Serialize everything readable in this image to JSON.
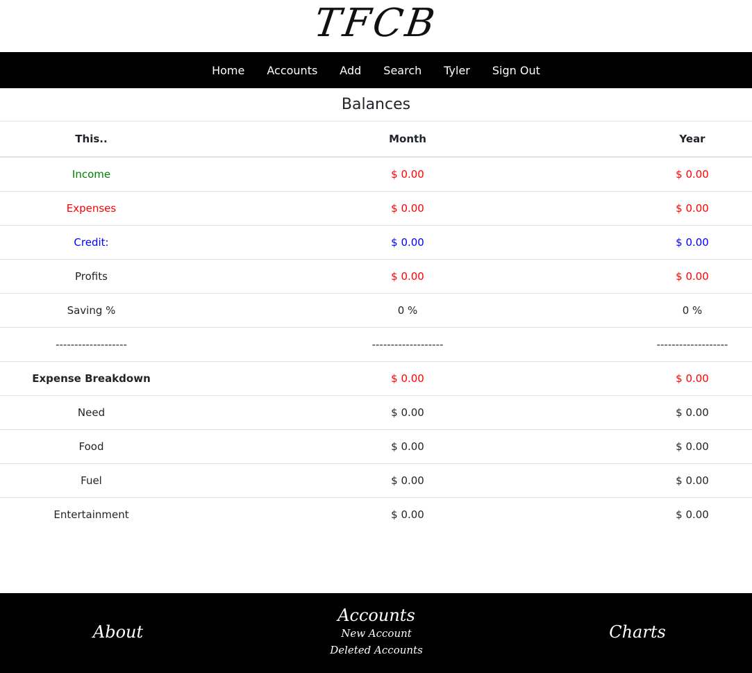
{
  "brand": {
    "logo_text": "TFCB"
  },
  "nav": {
    "items": [
      {
        "label": "Home"
      },
      {
        "label": "Accounts"
      },
      {
        "label": "Add"
      },
      {
        "label": "Search"
      },
      {
        "label": "Tyler"
      },
      {
        "label": "Sign Out"
      }
    ]
  },
  "balances": {
    "title": "Balances",
    "headers": {
      "col1": "This..",
      "col2": "Month",
      "col3": "Year"
    },
    "rows": [
      {
        "label": "Income",
        "month": "$ 0.00",
        "year": "$ 0.00"
      },
      {
        "label": "Expenses",
        "month": "$ 0.00",
        "year": "$ 0.00"
      },
      {
        "label": "Credit:",
        "month": "$ 0.00",
        "year": "$ 0.00"
      },
      {
        "label": "Profits",
        "month": "$ 0.00",
        "year": "$ 0.00"
      },
      {
        "label": "Saving %",
        "month": "0 %",
        "year": "0 %"
      },
      {
        "label": "-------------------",
        "month": "-------------------",
        "year": "-------------------"
      },
      {
        "label": "Expense Breakdown",
        "month": "$ 0.00",
        "year": "$ 0.00"
      },
      {
        "label": "Need",
        "month": "$ 0.00",
        "year": "$ 0.00"
      },
      {
        "label": "Food",
        "month": "$ 0.00",
        "year": "$ 0.00"
      },
      {
        "label": "Fuel",
        "month": "$ 0.00",
        "year": "$ 0.00"
      },
      {
        "label": "Entertainment",
        "month": "$ 0.00",
        "year": "$ 0.00"
      }
    ]
  },
  "footer": {
    "about": "About",
    "accounts": "Accounts",
    "new_account": "New Account",
    "deleted_accounts": "Deleted Accounts",
    "charts": "Charts"
  },
  "colors": {
    "income": "#008000",
    "negative": "#ff0000",
    "credit": "#0000ff",
    "nav_bg": "#000000"
  }
}
